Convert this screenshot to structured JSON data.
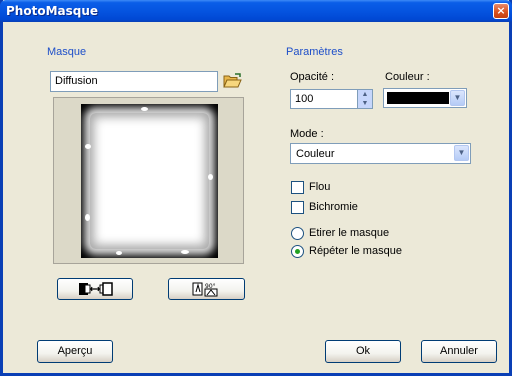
{
  "window": {
    "title": "PhotoMasque",
    "close_symbol": "×"
  },
  "mask_section": {
    "label": "Masque",
    "mask_name": "Diffusion"
  },
  "params_section": {
    "label": "Paramètres",
    "opacity_label": "Opacité :",
    "opacity_value": "100",
    "color_label": "Couleur :",
    "color_value": "#000000",
    "mode_label": "Mode :",
    "mode_value": "Couleur"
  },
  "options": {
    "flou_label": "Flou",
    "flou_checked": false,
    "bichromie_label": "Bichromie",
    "bichromie_checked": false,
    "stretch_label": "Etirer le masque",
    "repeat_label": "Répéter le masque",
    "selected_fit": "repeat"
  },
  "rotate_icon_text": "90°",
  "footer": {
    "preview_label": "Aperçu",
    "ok_label": "Ok",
    "cancel_label": "Annuler"
  },
  "colors": {
    "title_bar": "#0554e0",
    "section_label": "#1e4fc9",
    "dialog_bg": "#ece9d8",
    "radio_selected": "#21a121"
  }
}
